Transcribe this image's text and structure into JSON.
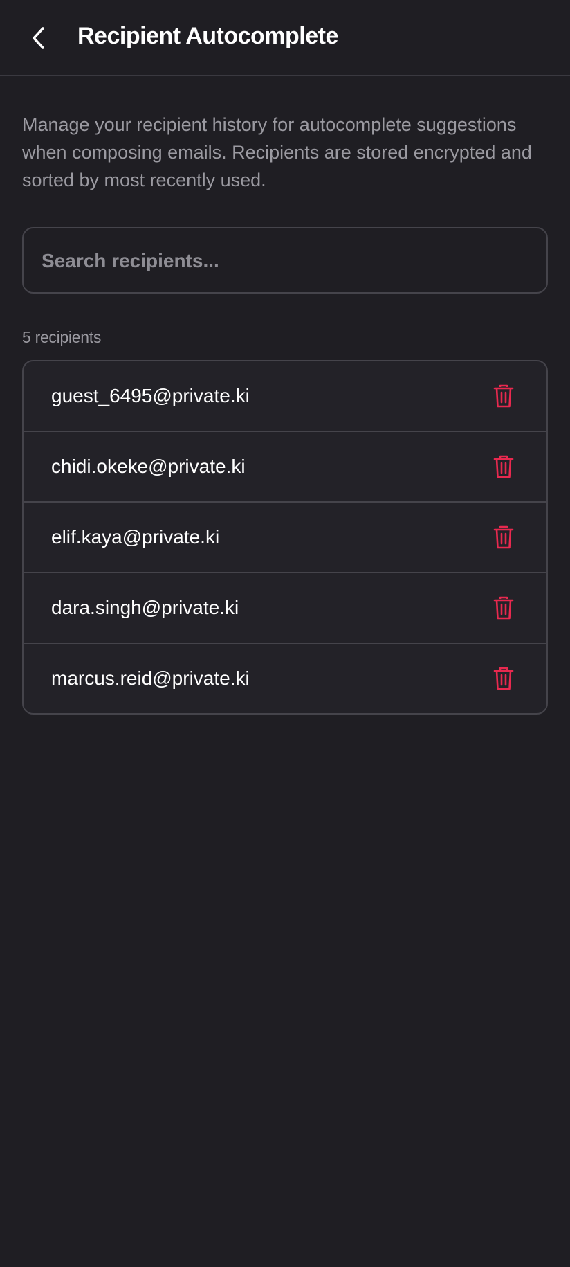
{
  "header": {
    "title": "Recipient Autocomplete",
    "back_icon": "chevron-left-icon"
  },
  "description": "Manage your recipient history for autocomplete suggestions when composing emails. Recipients are stored encrypted and sorted by most recently used.",
  "search": {
    "placeholder": "Search recipients...",
    "value": ""
  },
  "count_label": "5 recipients",
  "recipients": [
    {
      "email": "guest_6495@private.ki"
    },
    {
      "email": "chidi.okeke@private.ki"
    },
    {
      "email": "elif.kaya@private.ki"
    },
    {
      "email": "dara.singh@private.ki"
    },
    {
      "email": "marcus.reid@private.ki"
    }
  ],
  "colors": {
    "background": "#1f1e23",
    "delete_icon": "#e8294f",
    "text_primary": "#ffffff",
    "text_secondary": "#9b9aa1",
    "border": "#45444b"
  },
  "row_icon": "trash-icon"
}
